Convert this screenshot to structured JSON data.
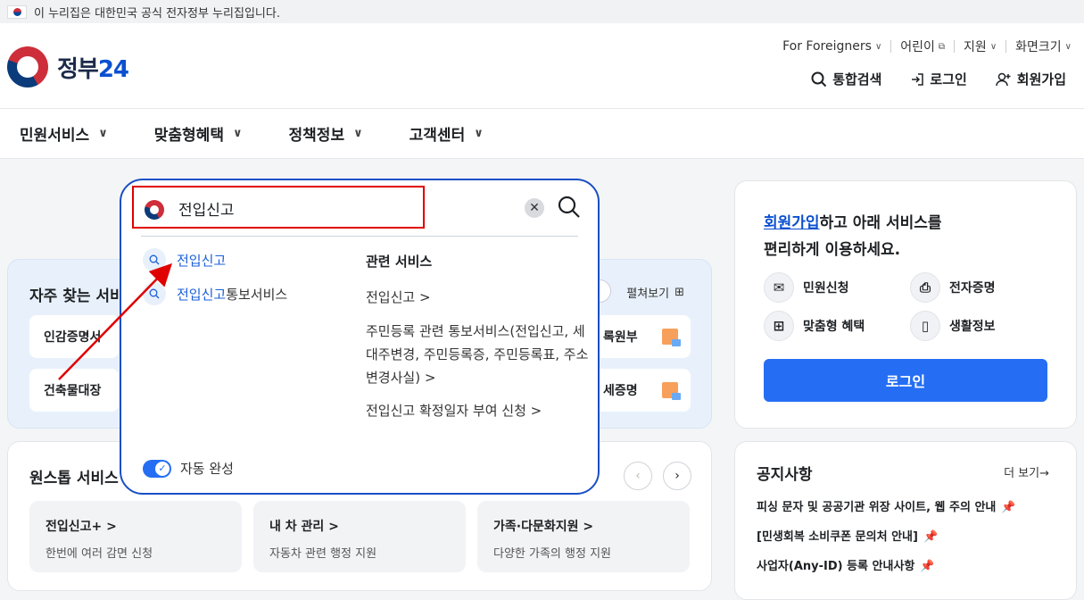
{
  "banner": {
    "text": "이 누리집은 대한민국 공식 전자정부 누리집입니다."
  },
  "logo": {
    "text_a": "정부",
    "text_b": "24"
  },
  "util": {
    "foreigners": "For Foreigners",
    "kids": "어린이",
    "support": "지원",
    "zoom": "화면크기"
  },
  "actions": {
    "search": "통합검색",
    "login": "로그인",
    "signup": "회원가입"
  },
  "nav": [
    "민원서비스",
    "맞춤형혜택",
    "정책정보",
    "고객센터"
  ],
  "freq": {
    "title": "자주 찾는 서비",
    "spread": "펼쳐보기",
    "cards": [
      "인감증명서",
      "건축물대장",
      "록원부",
      "세증명"
    ]
  },
  "onestop": {
    "title": "원스톱 서비스",
    "cards": [
      {
        "title": "전입신고+ >",
        "sub": "한번에 여러 감면 신청"
      },
      {
        "title": "내 차 관리 >",
        "sub": "자동차 관련 행정 지원"
      },
      {
        "title": "가족·다문화지원 >",
        "sub": "다양한 가족의 행정 지원"
      }
    ]
  },
  "login_panel": {
    "link": "회원가입",
    "msg1_rest": "하고 아래 서비스를",
    "msg2": "편리하게 이용하세요.",
    "services": [
      "민원신청",
      "전자증명",
      "맞춤형 혜택",
      "생활정보"
    ],
    "button": "로그인"
  },
  "notice": {
    "title": "공지사항",
    "more": "더 보기→",
    "items": [
      "피싱 문자 및 공공기관 위장 사이트, 웹 주의 안내",
      "[민생회복 소비쿠폰 문의처 안내]",
      "사업자(Any-ID) 등록 안내사항"
    ]
  },
  "search": {
    "query": "전입신고",
    "suggestions": [
      {
        "hl": "전입신고",
        "rest": ""
      },
      {
        "hl": "전입신고",
        "rest": "통보서비스"
      }
    ],
    "related_title": "관련 서비스",
    "related": [
      "전입신고 >",
      "주민등록 관련 통보서비스(전입신고, 세대주변경, 주민등록증, 주민등록표, 주소변경사실) >",
      "전입신고 확정일자 부여 신청 >"
    ],
    "autocomplete": "자동 완성"
  },
  "colors": {
    "primary": "#256ef4",
    "highlight": "#e00000",
    "popup_border": "#1a4fc4"
  }
}
